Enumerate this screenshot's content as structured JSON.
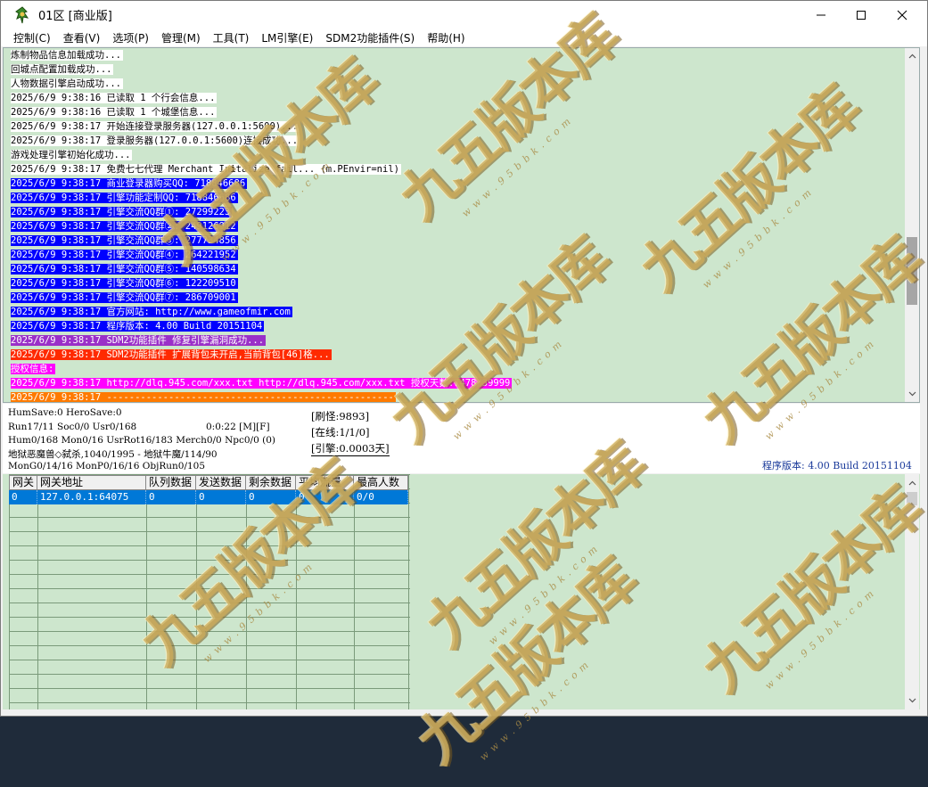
{
  "window": {
    "title": "01区 [商业版]",
    "minimize_glyph": "—",
    "maximize_glyph": "☐",
    "close_glyph": "✕",
    "icon": "app-icon"
  },
  "menu": [
    "控制(C)",
    "查看(V)",
    "选项(P)",
    "管理(M)",
    "工具(T)",
    "LM引擎(E)",
    "SDM2功能插件(S)",
    "帮助(H)"
  ],
  "log": [
    {
      "text": "炼制物品信息加载成功...",
      "style": "w"
    },
    {
      "text": "回城点配置加载成功...",
      "style": "w"
    },
    {
      "text": "人物数据引擎启动成功...",
      "style": "w"
    },
    {
      "text": "2025/6/9 9:38:16 已读取 1 个行会信息...",
      "style": "w"
    },
    {
      "text": "2025/6/9 9:38:16 已读取 1 个城堡信息...",
      "style": "w"
    },
    {
      "text": "2025/6/9 9:38:17 开始连接登录服务器(127.0.0.1:5600)...",
      "style": "w"
    },
    {
      "text": "2025/6/9 9:38:17 登录服务器(127.0.0.1:5600)连接成功...",
      "style": "w"
    },
    {
      "text": "游戏处理引擎初始化成功...",
      "style": "w"
    },
    {
      "text": "2025/6/9 9:38:17 免费七七代理 Merchant Initalize fail... (m.PEnvir=nil)",
      "style": "w"
    },
    {
      "text": "2025/6/9 9:38:17 商业登录器购买QQ: 718846686",
      "style": "b"
    },
    {
      "text": "2025/6/9 9:38:17 引擎功能定制QQ: 718846686",
      "style": "b"
    },
    {
      "text": "2025/6/9 9:38:17 引擎交流QQ群①: 27299223",
      "style": "b"
    },
    {
      "text": "2025/6/9 9:38:17 引擎交流QQ群②: 249126912",
      "style": "b"
    },
    {
      "text": "2025/6/9 9:38:17 引擎交流QQ群③: 277734856",
      "style": "b"
    },
    {
      "text": "2025/6/9 9:38:17 引擎交流QQ群④: 264221952",
      "style": "b"
    },
    {
      "text": "2025/6/9 9:38:17 引擎交流QQ群⑤: 140598634",
      "style": "b"
    },
    {
      "text": "2025/6/9 9:38:17 引擎交流QQ群⑥: 122209510",
      "style": "b"
    },
    {
      "text": "2025/6/9 9:38:17 引擎交流QQ群⑦: 286709001",
      "style": "b"
    },
    {
      "text": "2025/6/9 9:38:17 官方网站: http://www.gameofmir.com",
      "style": "b"
    },
    {
      "text": "2025/6/9 9:38:17 程序版本: 4.00 Build 20151104",
      "style": "b"
    },
    {
      "text": "2025/6/9 9:38:17 SDM2功能插件 修复引擎漏洞成功...",
      "style": "p"
    },
    {
      "text": "2025/6/9 9:38:17 SDM2功能插件 扩展背包未开启,当前背包[46]格...",
      "style": "r"
    },
    {
      "text": "授权信息:",
      "style": "m"
    },
    {
      "text": "2025/6/9 9:38:17 http://dlq.945.com/xxx.txt http://dlq.945.com/xxx.txt 授权天数:7478/39999",
      "style": "m"
    },
    {
      "text": "2025/6/9 9:38:17 ---------------------------------------------------",
      "style": "o"
    }
  ],
  "status": {
    "line1": "HumSave:0 HeroSave:0",
    "line2": "Run17/11 Soc0/0 Usr0/168",
    "line2b": "0:0:22 [M][F]",
    "line3": "Hum0/168 Mon0/16 UsrRot16/183 Merch0/0 Npc0/0 (0)",
    "line4": "地狱恶魔兽◇弑杀,1040/1995 - 地狱牛魔/114/90",
    "line5": "MonG0/14/16 MonP0/16/16 ObjRun0/105",
    "refresh_monster": "[刷怪:9893]",
    "online": "[在线:1/1/0]",
    "engine": "[引擎:0.0003天]",
    "version": "程序版本: 4.00 Build 20151104"
  },
  "gate": {
    "headers": [
      "网关",
      "网关地址",
      "队列数据",
      "发送数据",
      "剩余数据",
      "平均流量",
      "最高人数"
    ],
    "rows": [
      [
        "0",
        "127.0.0.1:64075",
        "0",
        "0",
        "0",
        "0",
        "0/0"
      ]
    ]
  },
  "watermark": {
    "text": "九五版本库",
    "subtext": "w w w . 9 5 b b k . c o m"
  },
  "colors": {
    "log_bg": "#cde6cd",
    "blue_line": "#0000ff",
    "purple_line": "#9a30c8",
    "red_line": "#ff2a00",
    "magenta_line": "#ff00ff",
    "orange_line": "#ff7a00",
    "selection": "#0078d7"
  }
}
